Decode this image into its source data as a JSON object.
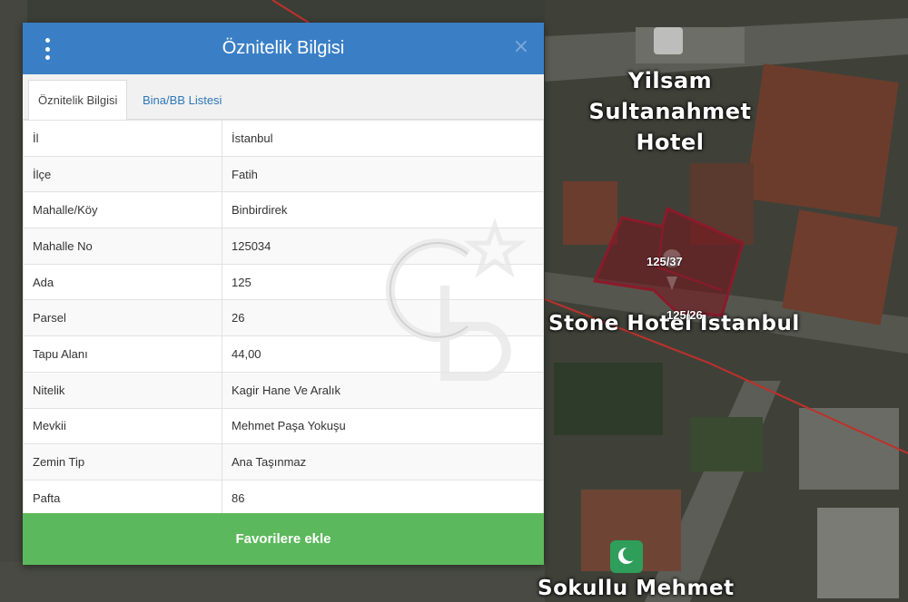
{
  "panel": {
    "title": "Öznitelik Bilgisi",
    "menu_icon": "kebab-menu-icon",
    "close_icon": "close-icon",
    "close_glyph": "×"
  },
  "tabs": [
    {
      "label": "Öznitelik Bilgisi",
      "active": true
    },
    {
      "label": "Bina/BB Listesi",
      "active": false
    }
  ],
  "attributes": [
    {
      "key": "İl",
      "value": "İstanbul"
    },
    {
      "key": "İlçe",
      "value": "Fatih"
    },
    {
      "key": "Mahalle/Köy",
      "value": "Binbirdirek"
    },
    {
      "key": "Mahalle No",
      "value": "125034"
    },
    {
      "key": "Ada",
      "value": "125"
    },
    {
      "key": "Parsel",
      "value": "26"
    },
    {
      "key": "Tapu Alanı",
      "value": "44,00"
    },
    {
      "key": "Nitelik",
      "value": "Kagir Hane Ve Aralık"
    },
    {
      "key": "Mevkii",
      "value": "Mehmet Paşa Yokuşu"
    },
    {
      "key": "Zemin Tip",
      "value": "Ana Taşınmaz"
    },
    {
      "key": "Pafta",
      "value": "86"
    }
  ],
  "favorite_button": {
    "label": "Favorilere ekle"
  },
  "map": {
    "labels": {
      "hotel_line1": "Yilsam",
      "hotel_line2": "Sultanahmet",
      "hotel_line3": "Hotel",
      "stone": "Stone Hotel Istanbul",
      "sokullu": "Sokullu Mehmet"
    },
    "parcels": [
      "125/37",
      "125/26"
    ]
  },
  "colors": {
    "header": "#3a7fc6",
    "favorite": "#5cb85c",
    "parcel_outline": "#8b1a2a",
    "tab_link": "#2f77b8"
  }
}
